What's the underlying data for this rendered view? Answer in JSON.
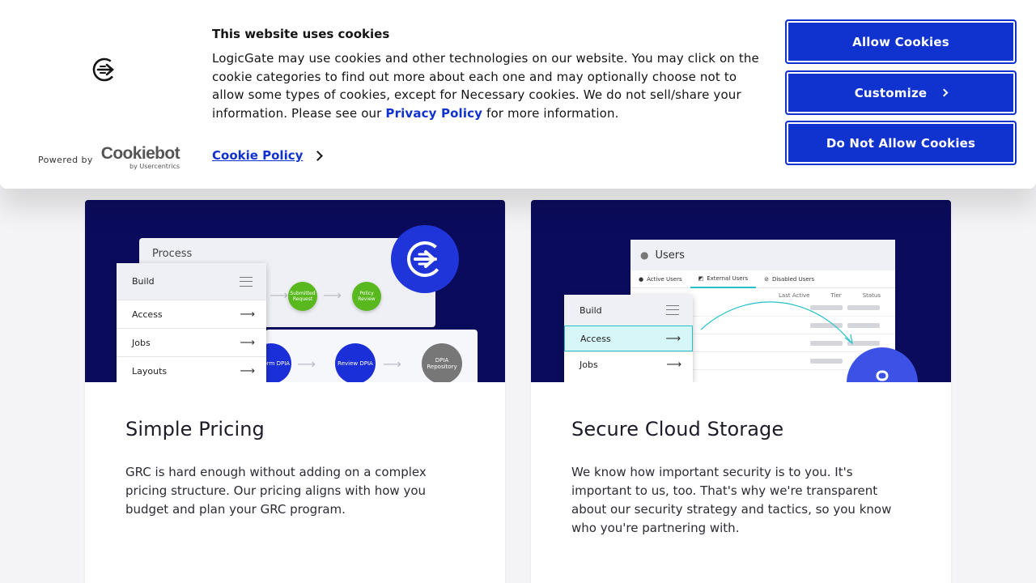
{
  "cookie_banner": {
    "title": "This website uses cookies",
    "body_text": "LogicGate may use cookies and other technologies on our website. You may click on the cookie categories to find out more about each one and may optionally choose not to allow some types of cookies, except for Necessary cookies.  We do not sell/share your information. Please see our ",
    "privacy_link": "Privacy Policy",
    "body_suffix": " for more information.",
    "cookie_policy_link": "Cookie Policy",
    "powered_by": "Powered by",
    "cookiebot_brand": "Cookiebot",
    "cookiebot_sub": "by Usercentrics",
    "buttons": {
      "allow": "Allow Cookies",
      "customize": "Customize",
      "deny": "Do Not Allow Cookies"
    },
    "brand_color": "#1032cf"
  },
  "cards": [
    {
      "title": "Simple Pricing",
      "text": "GRC is hard enough without adding on a complex pricing structure. Our pricing aligns with how you budget and plan your GRC program.",
      "illustration": {
        "panel_title": "Process",
        "menu_header": "Build",
        "menu_items": [
          "Access",
          "Jobs",
          "Layouts"
        ],
        "steps": [
          "Submitted Request",
          "Policy Review",
          "Perform DPIA",
          "Review DPIA",
          "DPIA Repository"
        ]
      }
    },
    {
      "title": "Secure Cloud Storage",
      "text": "We know how important security is to you. It's important to us, too. That's why we're transparent about our security strategy and tactics, so you know who you're partnering with.",
      "illustration": {
        "panel_title": "Users",
        "tabs": [
          "Active Users",
          "External Users",
          "Disabled Users"
        ],
        "columns": [
          "Last Active",
          "Tier",
          "Status"
        ],
        "menu_header": "Build",
        "menu_items": [
          "Access",
          "Jobs"
        ]
      }
    }
  ]
}
